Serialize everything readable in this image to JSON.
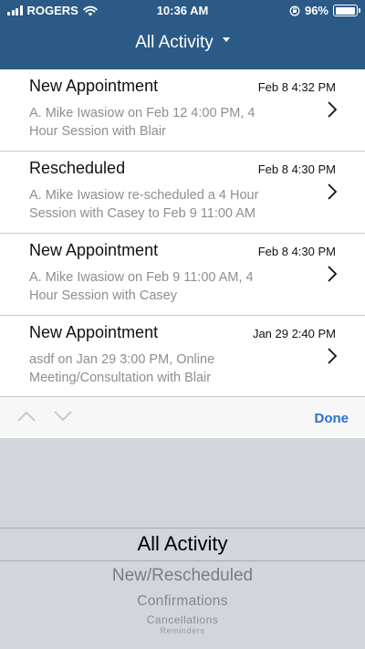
{
  "status_bar": {
    "carrier": "ROGERS",
    "time": "10:36 AM",
    "battery": "96%",
    "battery_level": 0.96,
    "icons": [
      "signal-icon",
      "wifi-icon",
      "orientation-lock-icon",
      "battery-icon"
    ]
  },
  "nav": {
    "title": "All Activity",
    "dropdown_icon": "caret-down-icon"
  },
  "activity": [
    {
      "title": "New Appointment",
      "date": "Feb 8 4:32 PM",
      "desc_line1": "A. Mike Iwasiow on Feb 12 4:00 PM, 4",
      "desc_line2": "Hour Session with Blair"
    },
    {
      "title": "Rescheduled",
      "date": "Feb 8 4:30 PM",
      "desc_line1": "A. Mike Iwasiow re-scheduled a 4 Hour",
      "desc_line2": "Session with Casey to Feb 9 11:00 AM"
    },
    {
      "title": "New Appointment",
      "date": "Feb 8 4:30 PM",
      "desc_line1": "A. Mike Iwasiow on Feb 9 11:00 AM, 4",
      "desc_line2": "Hour Session with Casey"
    },
    {
      "title": "New Appointment",
      "date": "Jan 29 2:40 PM",
      "desc_line1": "asdf on Jan 29 3:00 PM, Online",
      "desc_line2": "Meeting/Consultation with Blair"
    }
  ],
  "toolbar": {
    "done_label": "Done",
    "colors": {
      "accent": "#2d6ed0"
    }
  },
  "picker": {
    "selected": "All Activity",
    "options": [
      "New/Rescheduled",
      "Confirmations",
      "Cancellations",
      "Reminders"
    ]
  },
  "colors": {
    "nav_bg": "#2b5a86",
    "secondary_text": "#8e8e93",
    "picker_bg": "#d2d5db"
  }
}
